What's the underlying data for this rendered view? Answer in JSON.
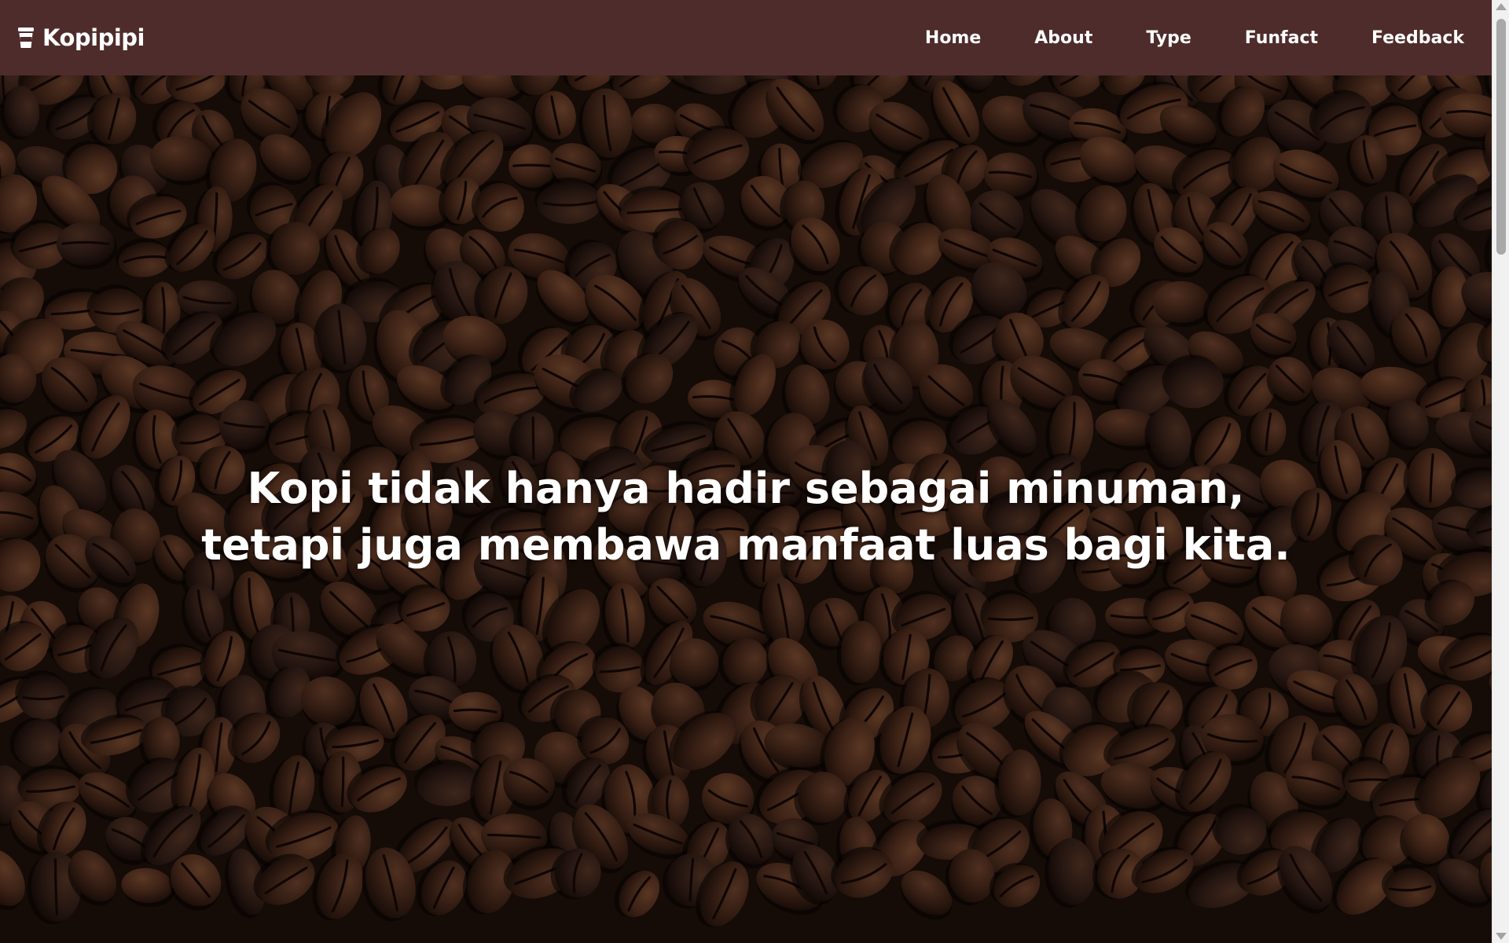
{
  "brand": {
    "name": "Kopipipi",
    "icon": "coffee-cup-icon"
  },
  "nav": {
    "items": [
      {
        "label": "Home"
      },
      {
        "label": "About"
      },
      {
        "label": "Type"
      },
      {
        "label": "Funfact"
      },
      {
        "label": "Feedback"
      }
    ]
  },
  "hero": {
    "line1": "Kopi tidak hanya hadir sebagai minuman,",
    "line2": "tetapi juga membawa manfaat luas bagi kita."
  },
  "colors": {
    "navbar_bg": "#4e2c2b",
    "text": "#ffffff",
    "bean_dark": "#2a1812",
    "bean_light": "#6e4330"
  }
}
